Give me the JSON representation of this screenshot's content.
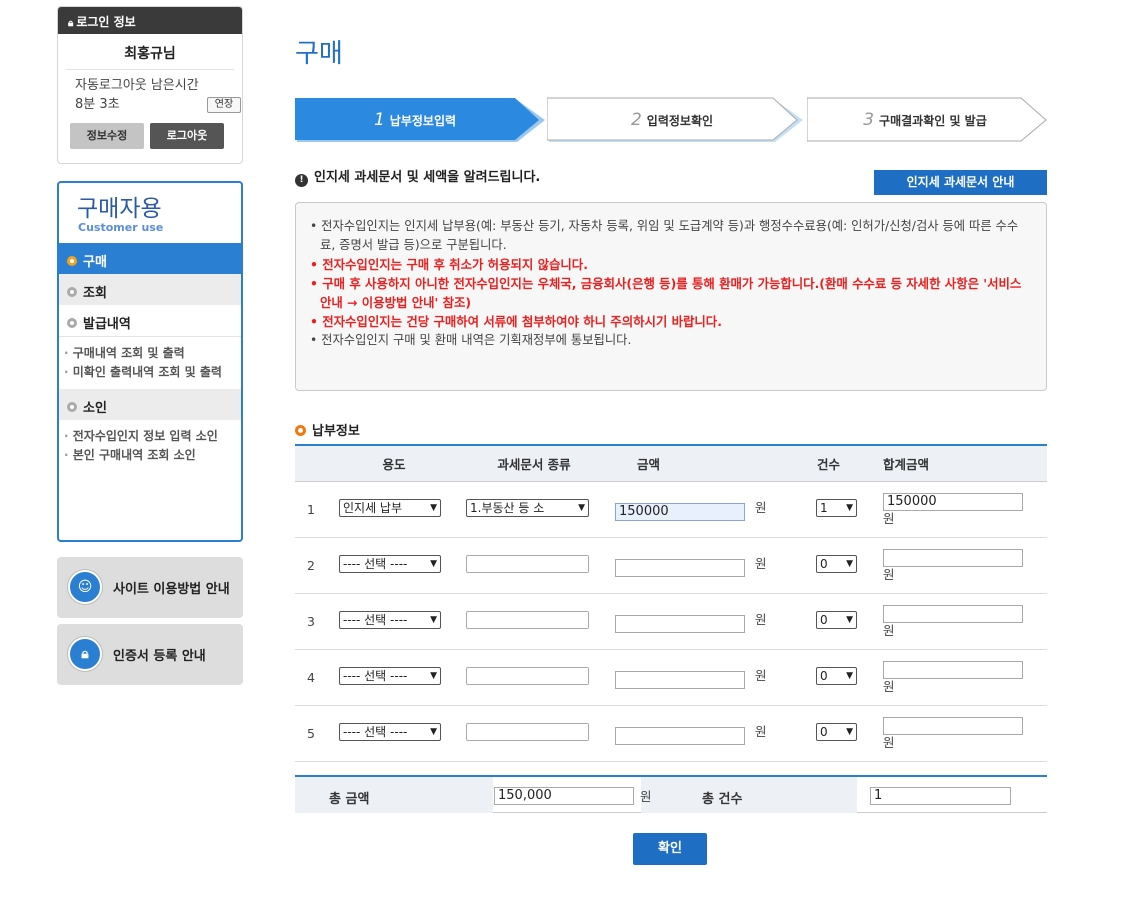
{
  "login": {
    "header": "로그인 정보",
    "user": "최홍규님",
    "auto_logout_label": "자동로그아웃 남은시간",
    "remaining_time": "8분 3초",
    "extend_button": "연장",
    "edit_button": "정보수정",
    "logout_button": "로그아웃"
  },
  "sidebar": {
    "title": "구매자용",
    "subtitle": "Customer use",
    "items": [
      {
        "label": "구매"
      },
      {
        "label": "조회"
      },
      {
        "label": "발급내역"
      }
    ],
    "issue_submenu": [
      "구매내역 조회 및 출력",
      "미확인 출력내역 조회 및 출력"
    ],
    "seal_item": {
      "label": "소인"
    },
    "seal_submenu": [
      "전자수입인지 정보 입력 소인",
      "본인 구매내역 조회 소인"
    ]
  },
  "guides": {
    "site_usage": "사이트 이용방법 안내",
    "cert_register": "인증서 등록 안내"
  },
  "page": {
    "title": "구매"
  },
  "steps": [
    {
      "num": "1",
      "label": "납부정보입력"
    },
    {
      "num": "2",
      "label": "입력정보확인"
    },
    {
      "num": "3",
      "label": "구매결과확인 및 발급"
    }
  ],
  "notice": {
    "heading": "인지세 과세문서 및 세액을 알려드립니다.",
    "guide_button": "인지세 과세문서 안내",
    "lines": [
      "전자수입인지는 인지세 납부용(예: 부동산 등기, 자동차 등록, 위임 및 도급계약 등)과 행정수수료용(예: 인허가/신청/검사 등에 따른 수수료, 증명서 발급 등)으로 구분됩니다.",
      "전자수입인지는 구매 후 취소가 허용되지 않습니다.",
      "구매 후 사용하지 아니한 전자수입인지는 우체국, 금융회사(은행 등)를 통해 환매가 가능합니다.(환매 수수료 등 자세한 사항은 '서비스안내 → 이용방법 안내' 참조)",
      "전자수입인지는 건당 구매하여 서류에 첨부하여야 하니 주의하시기 바랍니다.",
      "전자수입인지 구매 및 환매 내역은 기획재정부에 통보됩니다."
    ]
  },
  "payment": {
    "heading": "납부정보",
    "columns": [
      "용도",
      "과세문서 종류",
      "금액",
      "건수",
      "합계금액"
    ],
    "unit": "원",
    "rows": [
      {
        "no": "1",
        "purpose": "인지세 납부",
        "doc_type": "1.부동산 등 소",
        "amount": "150000",
        "count": "1",
        "total": "150000"
      },
      {
        "no": "2",
        "purpose": "---- 선택 ----",
        "doc_type": "",
        "amount": "",
        "count": "0",
        "total": ""
      },
      {
        "no": "3",
        "purpose": "---- 선택 ----",
        "doc_type": "",
        "amount": "",
        "count": "0",
        "total": ""
      },
      {
        "no": "4",
        "purpose": "---- 선택 ----",
        "doc_type": "",
        "amount": "",
        "count": "0",
        "total": ""
      },
      {
        "no": "5",
        "purpose": "---- 선택 ----",
        "doc_type": "",
        "amount": "",
        "count": "0",
        "total": ""
      }
    ]
  },
  "totals": {
    "amount_label": "총 금액",
    "amount": "150,000",
    "unit": "원",
    "count_label": "총 건수",
    "count": "1"
  },
  "confirm_button": "확인",
  "colors": {
    "accent": "#2b7fd3",
    "title": "#2271c7",
    "warning": "#e8201f",
    "orange": "#f5780a"
  }
}
